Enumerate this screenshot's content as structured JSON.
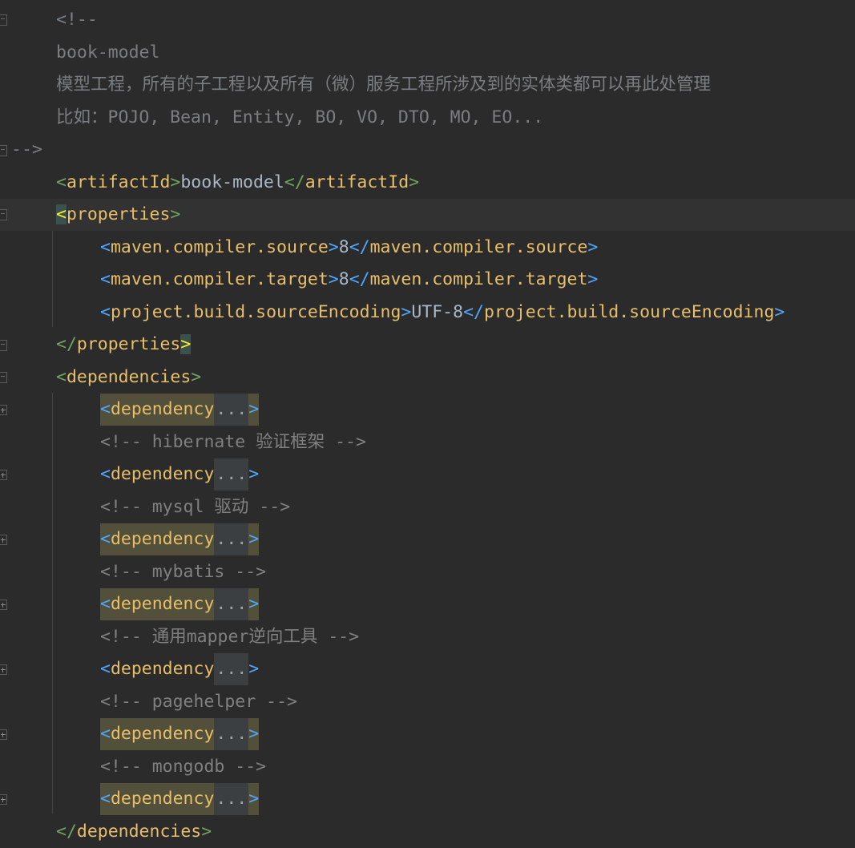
{
  "editor": {
    "comment_open": "<!--",
    "comment_lines": [
      "book-model",
      "模型工程，所有的子工程以及所有（微）服务工程所涉及到的实体类都可以再此处管理",
      "比如：POJO, Bean, Entity, BO, VO, DTO, MO, EO..."
    ],
    "comment_close": "-->",
    "artifact": {
      "tag": "artifactId",
      "value": "book-model"
    },
    "properties": {
      "tag": "properties",
      "items": [
        {
          "tag": "maven.compiler.source",
          "value": "8"
        },
        {
          "tag": "maven.compiler.target",
          "value": "8"
        },
        {
          "tag": "project.build.sourceEncoding",
          "value": "UTF-8"
        }
      ]
    },
    "dependencies": {
      "tag": "dependencies",
      "dep_tag": "dependency",
      "fold_placeholder": "...",
      "comments": [
        "<!-- hibernate 验证框架 -->",
        "<!-- mysql 驱动 -->",
        "<!-- mybatis -->",
        "<!-- 通用mapper逆向工具 -->",
        "<!-- pagehelper -->",
        "<!-- mongodb -->"
      ]
    }
  },
  "colors": {
    "background": "#2b2b2b",
    "tag": "#e8bf6a",
    "comment": "#808080",
    "text": "#a9b7c6",
    "bracket_green": "#6fa35e",
    "bracket_blue": "#4fa6ff",
    "match_highlight": "#ffef28"
  }
}
